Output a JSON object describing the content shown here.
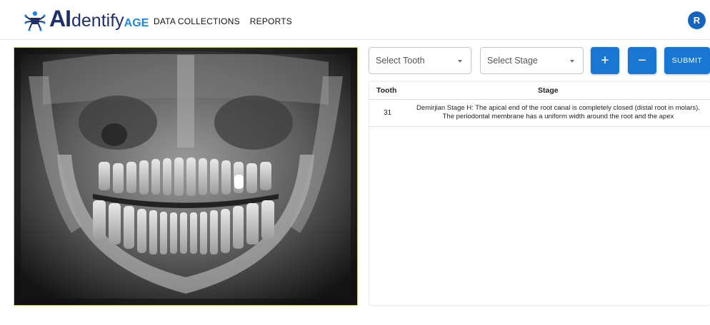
{
  "app": {
    "logo_ai": "AI",
    "logo_dentify": "dentify",
    "logo_age": "AGE",
    "user_initial": "R"
  },
  "nav": {
    "items": [
      {
        "label": "DATA COLLECTIONS"
      },
      {
        "label": "REPORTS"
      }
    ]
  },
  "controls": {
    "tooth_placeholder": "Select Tooth",
    "stage_placeholder": "Select Stage",
    "add_label": "+",
    "remove_label": "−",
    "submit_label": "SUBMIT"
  },
  "table": {
    "headers": {
      "tooth": "Tooth",
      "stage": "Stage"
    },
    "rows": [
      {
        "tooth": "31",
        "stage_line1": "Demirjian Stage H: The apical end of the root canal is completely closed (distal root in molars).",
        "stage_line2": "The periodontal membrane has a uniform width around the root and the apex"
      }
    ]
  },
  "colors": {
    "brand_navy": "#1e2f6e",
    "brand_blue": "#1e88e5",
    "button_blue": "#1976d2",
    "avatar_blue": "#1565c0"
  },
  "image": {
    "description_icon": "dental-panoramic-xray"
  }
}
